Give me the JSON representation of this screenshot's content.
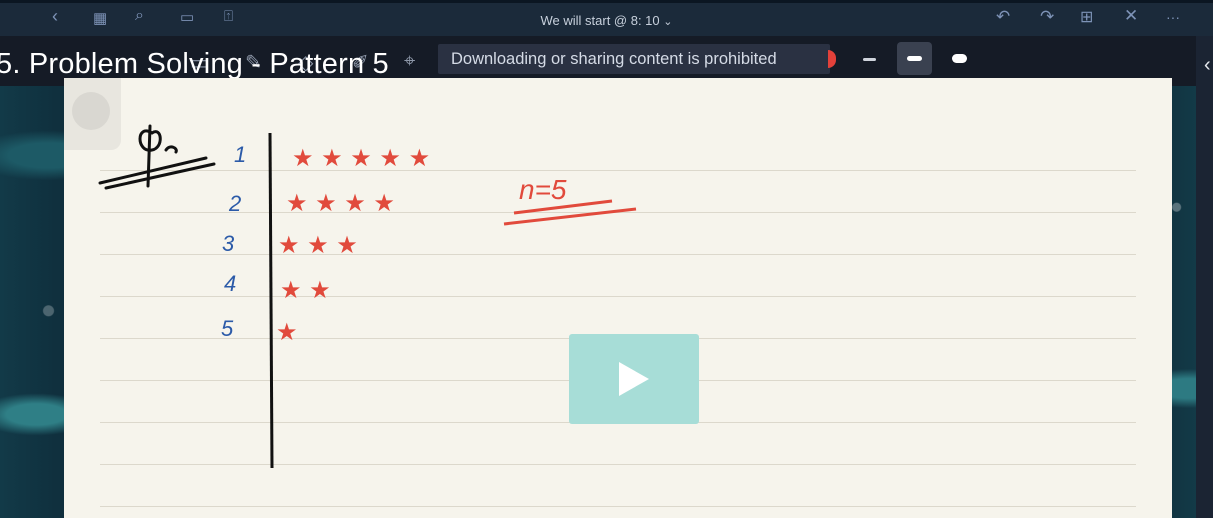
{
  "window": {
    "title": "We will start @ 8: 10",
    "title_chevron": "⌄"
  },
  "toolbar": {
    "left_icons": [
      "back-icon",
      "grid-icon",
      "search-icon",
      "bookmark-icon",
      "share-icon"
    ],
    "right_icons": [
      "undo-icon",
      "redo-icon",
      "add-page-icon",
      "close-icon",
      "more-icon"
    ]
  },
  "page": {
    "heading": "5. Problem Solving - Pattern 5"
  },
  "banner": {
    "text": "Downloading or sharing content is prohibited"
  },
  "pen_sizes": [
    "thin",
    "medium",
    "thick"
  ],
  "selected_pen": "medium",
  "colors": {
    "ink_blue": "#2b5aa8",
    "ink_red": "#e14a3c",
    "ink_black": "#111111",
    "play_button": "#a7ddd7"
  },
  "notes": {
    "question_label": "Q.",
    "row_numbers": [
      "1",
      "2",
      "3",
      "4",
      "5"
    ],
    "rows": [
      "★ ★ ★ ★ ★",
      "★ ★ ★ ★",
      "★ ★ ★",
      "★ ★",
      "★"
    ],
    "side_note": "n=5"
  },
  "player": {
    "play_icon": "play-icon"
  }
}
